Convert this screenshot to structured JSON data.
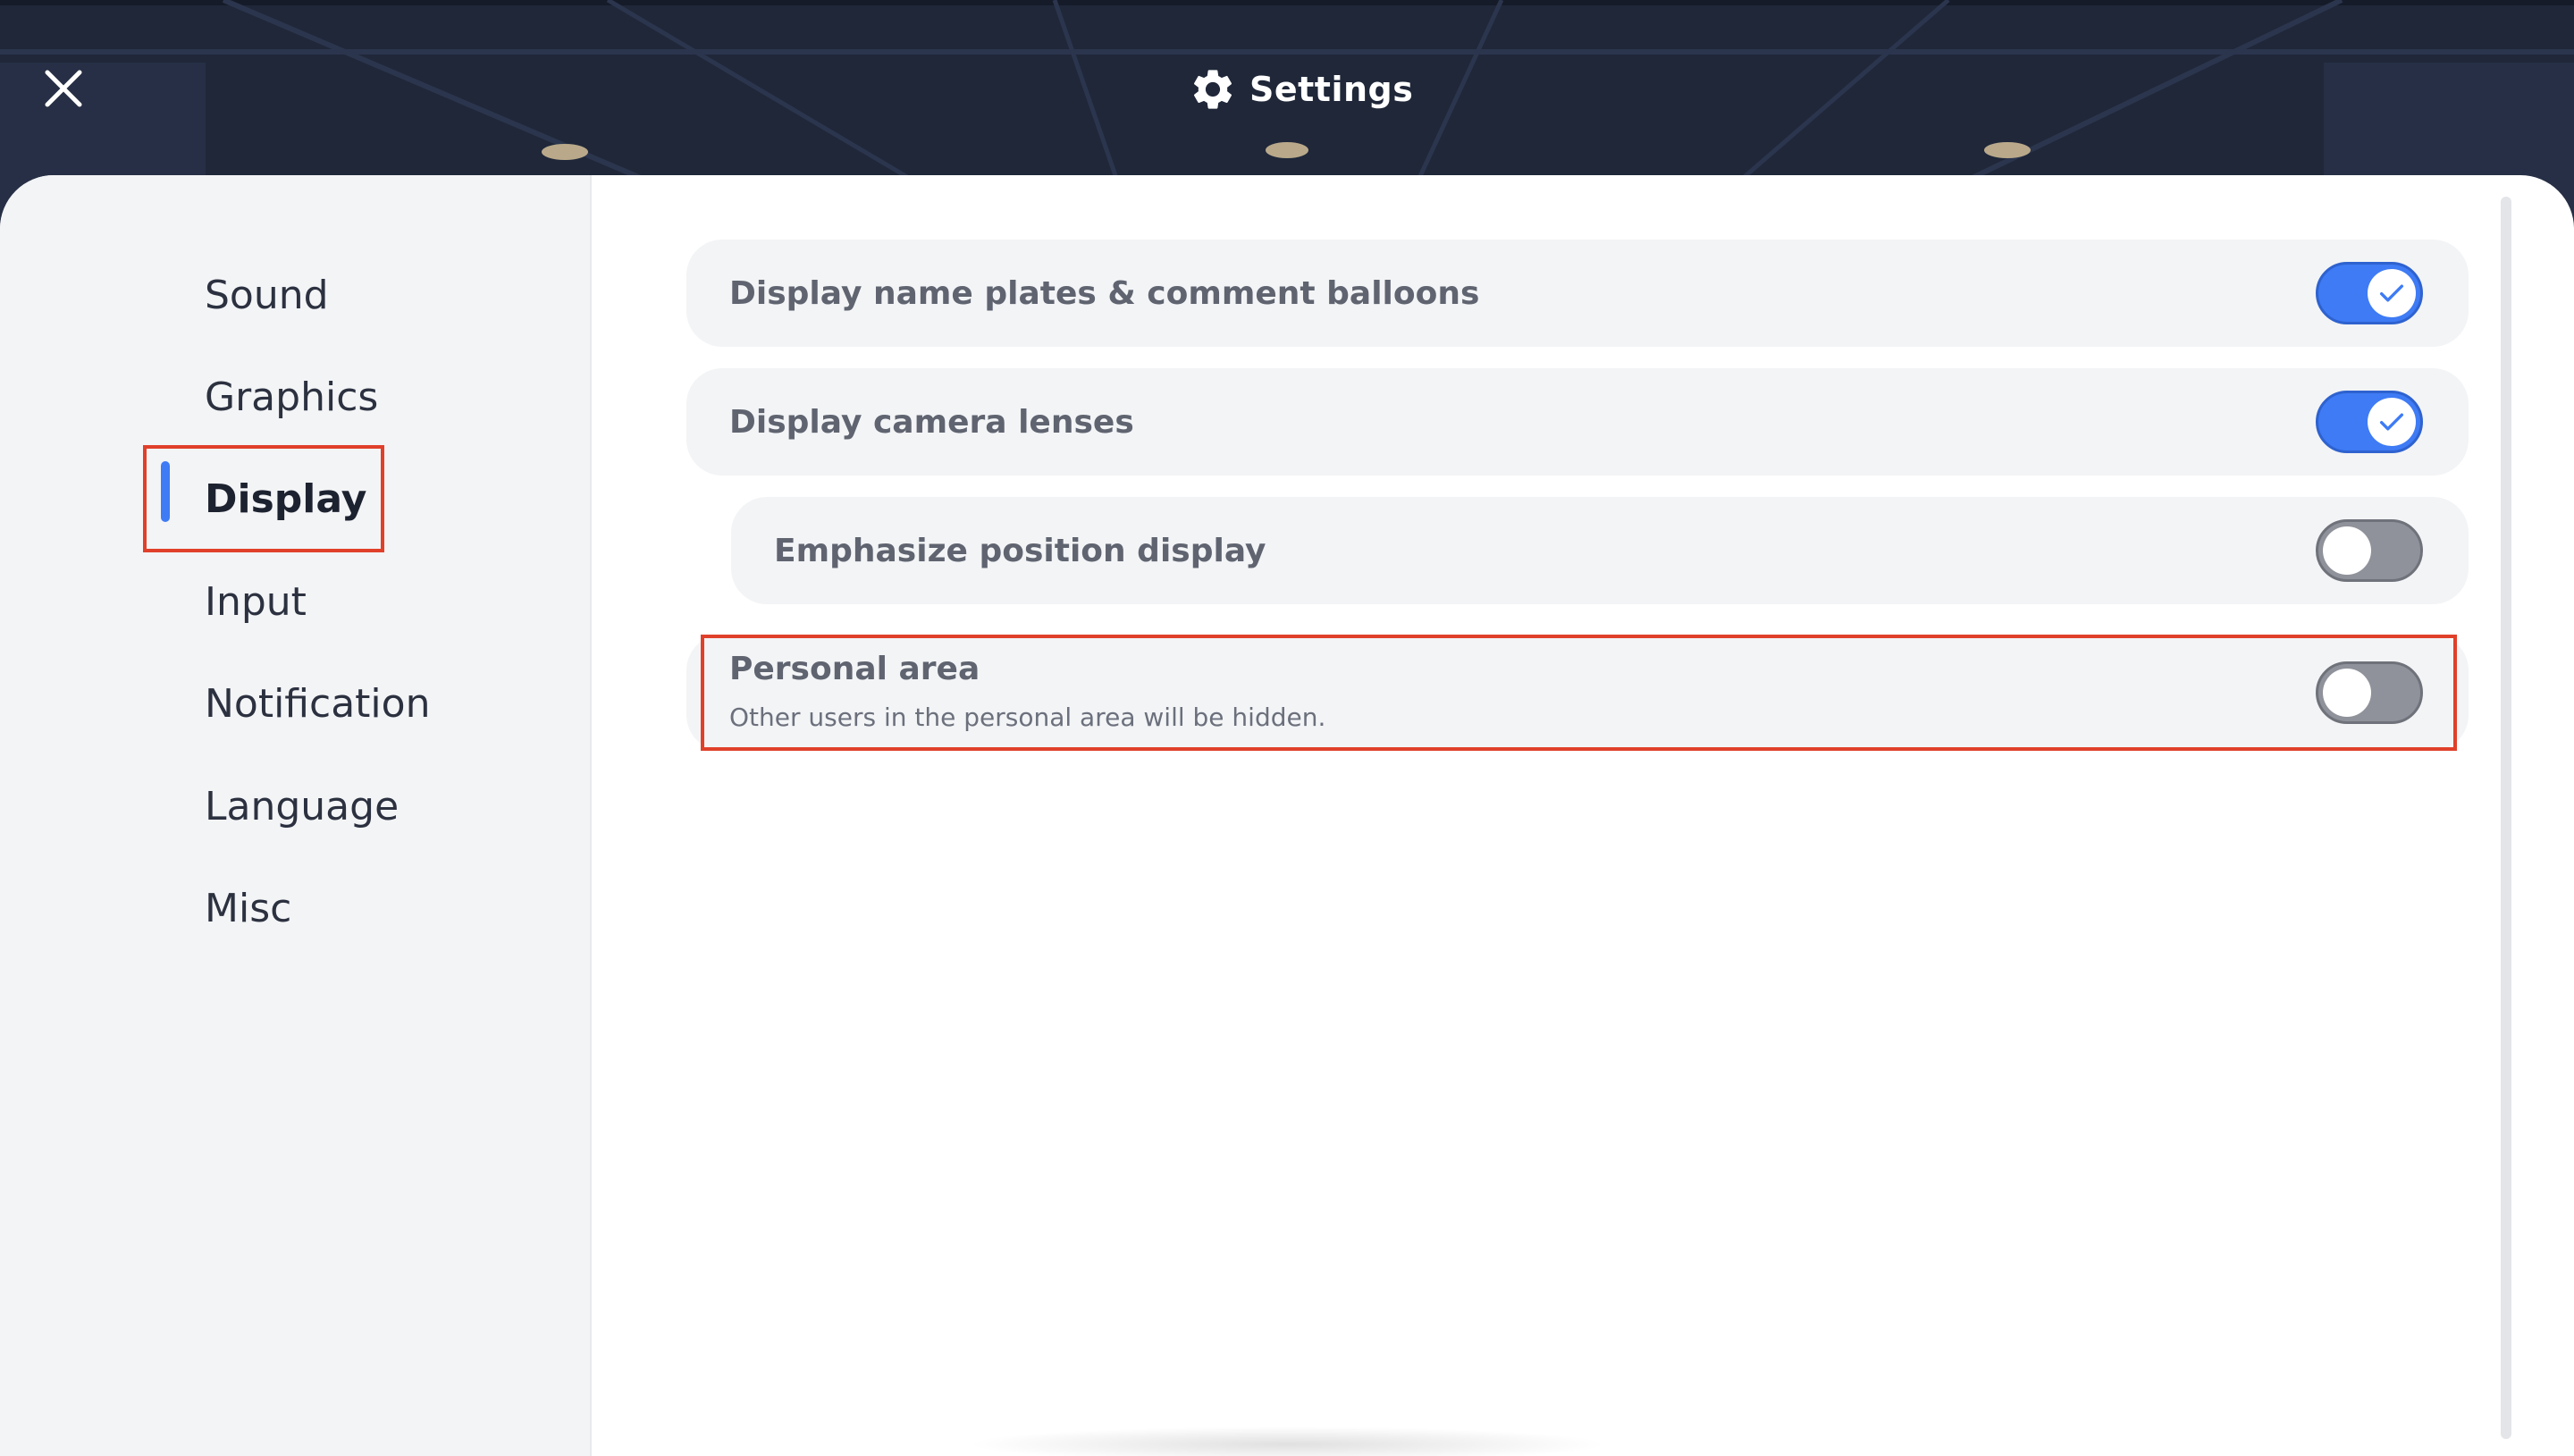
{
  "header": {
    "title": "Settings",
    "gear_icon": "gear-icon",
    "close_icon": "close-icon"
  },
  "sidebar": {
    "items": [
      {
        "label": "Sound",
        "active": false
      },
      {
        "label": "Graphics",
        "active": false
      },
      {
        "label": "Display",
        "active": true
      },
      {
        "label": "Input",
        "active": false
      },
      {
        "label": "Notification",
        "active": false
      },
      {
        "label": "Language",
        "active": false
      },
      {
        "label": "Misc",
        "active": false
      }
    ]
  },
  "settings": [
    {
      "label": "Display name plates & comment balloons",
      "enabled": true
    },
    {
      "label": "Display camera lenses",
      "enabled": true
    },
    {
      "label": "Emphasize position display",
      "enabled": false
    },
    {
      "label": "Personal area",
      "description": "Other users in the personal area will be hidden.",
      "enabled": false
    }
  ],
  "colors": {
    "accent": "#3e7bf5",
    "highlight": "#e0402a",
    "toggle_off": "#8f929a",
    "header_bg": "#1d2538"
  }
}
